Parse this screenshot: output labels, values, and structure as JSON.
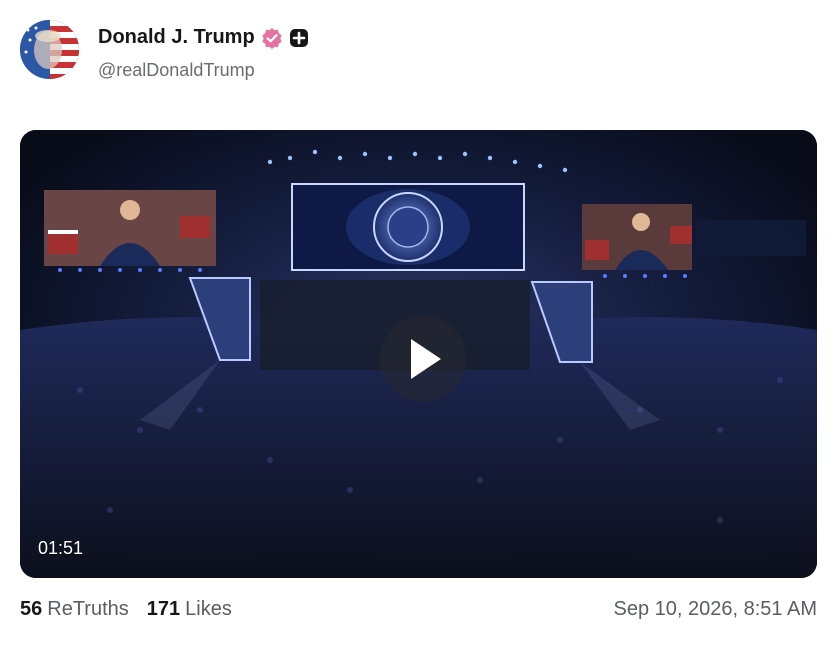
{
  "post": {
    "author": {
      "display_name": "Donald J. Trump",
      "handle": "@realDonaldTrump",
      "avatar_icon": "flag-portrait-avatar",
      "verified_icon": "verified-badge-icon",
      "plus_icon": "plus-badge-icon"
    },
    "media": {
      "type": "video",
      "duration": "01:51",
      "play_icon": "play-icon"
    },
    "stats": {
      "retruths_count": "56",
      "retruths_label": "ReTruths",
      "likes_count": "171",
      "likes_label": "Likes"
    },
    "timestamp": "Sep 10, 2026, 8:51 AM"
  },
  "colors": {
    "verified": "#e6739f",
    "text_primary": "#17171a",
    "text_secondary": "#5c5c66"
  }
}
